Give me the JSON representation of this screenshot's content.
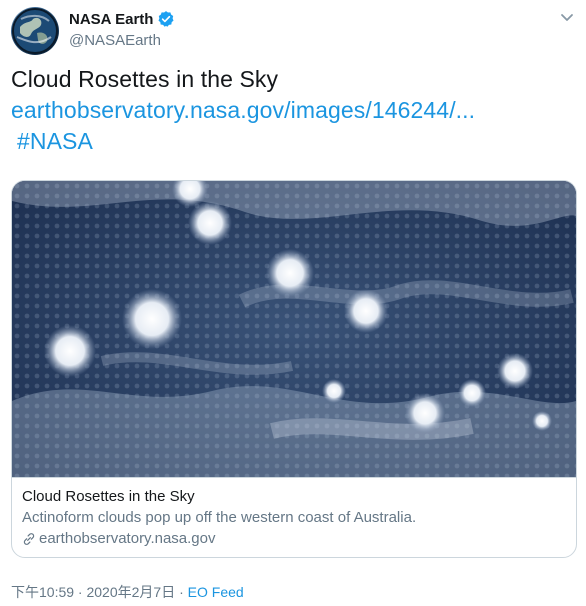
{
  "author": {
    "display_name": "NASA Earth",
    "handle": "@NASAEarth",
    "verified": true,
    "avatar_icon": "earth-globe-icon"
  },
  "tweet": {
    "text": "Cloud Rosettes in the Sky",
    "link": "earthobservatory.nasa.gov/images/146244/...",
    "hashtag": "#NASA"
  },
  "card": {
    "image_icon": "satellite-cloud-image",
    "title": "Cloud Rosettes in the Sky",
    "description": "Actinoform clouds pop up off the western coast of Australia.",
    "domain": "earthobservatory.nasa.gov"
  },
  "meta": {
    "timestamp": "下午10:59 · 2020年2月7日",
    "separator": " · ",
    "source": "EO Feed"
  },
  "colors": {
    "link": "#1b95e0",
    "text": "#14171a",
    "secondary": "#657786",
    "verified": "#1da1f2",
    "border": "#ccd6dd"
  }
}
